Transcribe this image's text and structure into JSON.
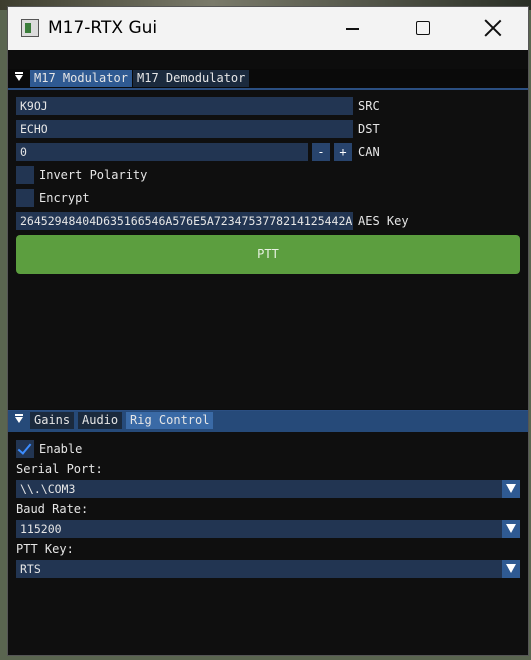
{
  "window": {
    "title": "M17-RTX Gui"
  },
  "modulator": {
    "tabs": [
      {
        "label": "M17 Modulator",
        "selected": true
      },
      {
        "label": "M17 Demodulator",
        "selected": false
      }
    ],
    "src": {
      "value": "K9OJ",
      "label": "SRC"
    },
    "dst": {
      "value": "ECHO",
      "label": "DST"
    },
    "can": {
      "value": "0",
      "label": "CAN",
      "minus": "-",
      "plus": "+"
    },
    "invert_polarity": {
      "label": "Invert Polarity",
      "checked": false
    },
    "encrypt": {
      "label": "Encrypt",
      "checked": false
    },
    "aes_key": {
      "value": "26452948404D635166546A576E5A7234753778214125442A",
      "label": "AES Key"
    },
    "ptt_label": "PTT"
  },
  "rig": {
    "tabs": [
      {
        "label": "Gains",
        "selected": false
      },
      {
        "label": "Audio",
        "selected": false
      },
      {
        "label": "Rig Control",
        "selected": true
      }
    ],
    "enable": {
      "label": "Enable",
      "checked": true
    },
    "serial_port": {
      "label": "Serial Port:",
      "value": "\\\\.\\COM3"
    },
    "baud_rate": {
      "label": "Baud Rate:",
      "value": "115200"
    },
    "ptt_key": {
      "label": "PTT Key:",
      "value": "RTS"
    }
  },
  "colors": {
    "accent": "#2f5a92",
    "ptt": "#5c9e3f",
    "field": "#223552",
    "check": "#3c8dff"
  }
}
